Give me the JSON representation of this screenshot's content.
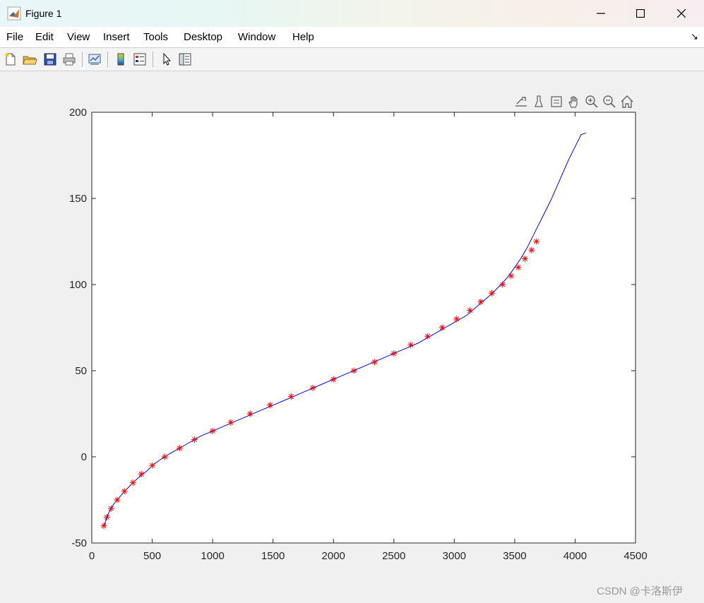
{
  "window": {
    "title": "Figure 1",
    "minimize_glyph": "─",
    "maximize_glyph": "☐",
    "close_glyph": "✕"
  },
  "menu": {
    "items": [
      "File",
      "Edit",
      "View",
      "Insert",
      "Tools",
      "Desktop",
      "Window",
      "Help"
    ],
    "dock_arrow": "↘"
  },
  "toolbar": {
    "icons": [
      "new-figure-icon",
      "open-file-icon",
      "save-icon",
      "print-icon",
      "link-plot-icon",
      "insert-colorbar-icon",
      "insert-legend-icon",
      "edit-plot-icon",
      "property-inspector-icon"
    ]
  },
  "axes_toolbar": {
    "icons": [
      "export-icon",
      "brush-icon",
      "data-tips-icon",
      "pan-icon",
      "zoom-in-icon",
      "zoom-out-icon",
      "restore-view-icon"
    ]
  },
  "watermark": "CSDN @卡洛斯伊",
  "chart_data": {
    "type": "line",
    "title": "",
    "xlabel": "",
    "ylabel": "",
    "xlim": [
      0,
      4500
    ],
    "ylim": [
      -50,
      200
    ],
    "xticks": [
      "0",
      "500",
      "1000",
      "1500",
      "2000",
      "2500",
      "3000",
      "3500",
      "4000",
      "4500"
    ],
    "yticks": [
      "-50",
      "0",
      "50",
      "100",
      "150",
      "200"
    ],
    "grid": false,
    "legend": "none",
    "series": [
      {
        "style": "line",
        "color": "#0000ff",
        "x": [
          100,
          110,
          125,
          140,
          160,
          180,
          210,
          240,
          270,
          300,
          340,
          380,
          420,
          460,
          500,
          550,
          600,
          650,
          700,
          800,
          900,
          1000,
          1100,
          1200,
          1300,
          1400,
          1500,
          1600,
          1700,
          1800,
          1900,
          2000,
          2100,
          2200,
          2300,
          2400,
          2500,
          2600,
          2700,
          2800,
          2900,
          3000,
          3100,
          3200,
          3300,
          3400,
          3450,
          3500,
          3550,
          3600,
          3650,
          3700,
          3750,
          3800,
          3850,
          3900,
          3950,
          4000,
          4050,
          4090
        ],
        "y": [
          -40,
          -38.5,
          -35,
          -32.5,
          -30,
          -27.5,
          -25,
          -22.5,
          -20,
          -18,
          -15,
          -12.5,
          -10,
          -8,
          -5,
          -2.5,
          0,
          2,
          4,
          8,
          12,
          15,
          18,
          21,
          24,
          27,
          30,
          33,
          36,
          39,
          42,
          45,
          48,
          51,
          54,
          57,
          60,
          63,
          66,
          70,
          74,
          78,
          82,
          88,
          94,
          101,
          105,
          110,
          115,
          121,
          128,
          135,
          142,
          149,
          157,
          165,
          173,
          180,
          187,
          188
        ]
      },
      {
        "style": "marker",
        "marker": "*",
        "color": "#ff0000",
        "x": [
          100,
          125,
          160,
          210,
          270,
          340,
          410,
          500,
          605,
          727,
          850,
          1000,
          1150,
          1310,
          1475,
          1650,
          1830,
          2000,
          2170,
          2340,
          2500,
          2640,
          2780,
          2900,
          3020,
          3130,
          3220,
          3310,
          3400,
          3470,
          3530,
          3585,
          3640,
          3680
        ],
        "y": [
          -40,
          -35,
          -30,
          -25,
          -20,
          -15,
          -10,
          -5,
          0,
          5,
          10,
          15,
          20,
          25,
          30,
          35,
          40,
          45,
          50,
          55,
          60,
          65,
          70,
          75,
          80,
          85,
          90,
          95,
          100,
          105,
          110,
          115,
          120,
          125
        ]
      }
    ]
  }
}
